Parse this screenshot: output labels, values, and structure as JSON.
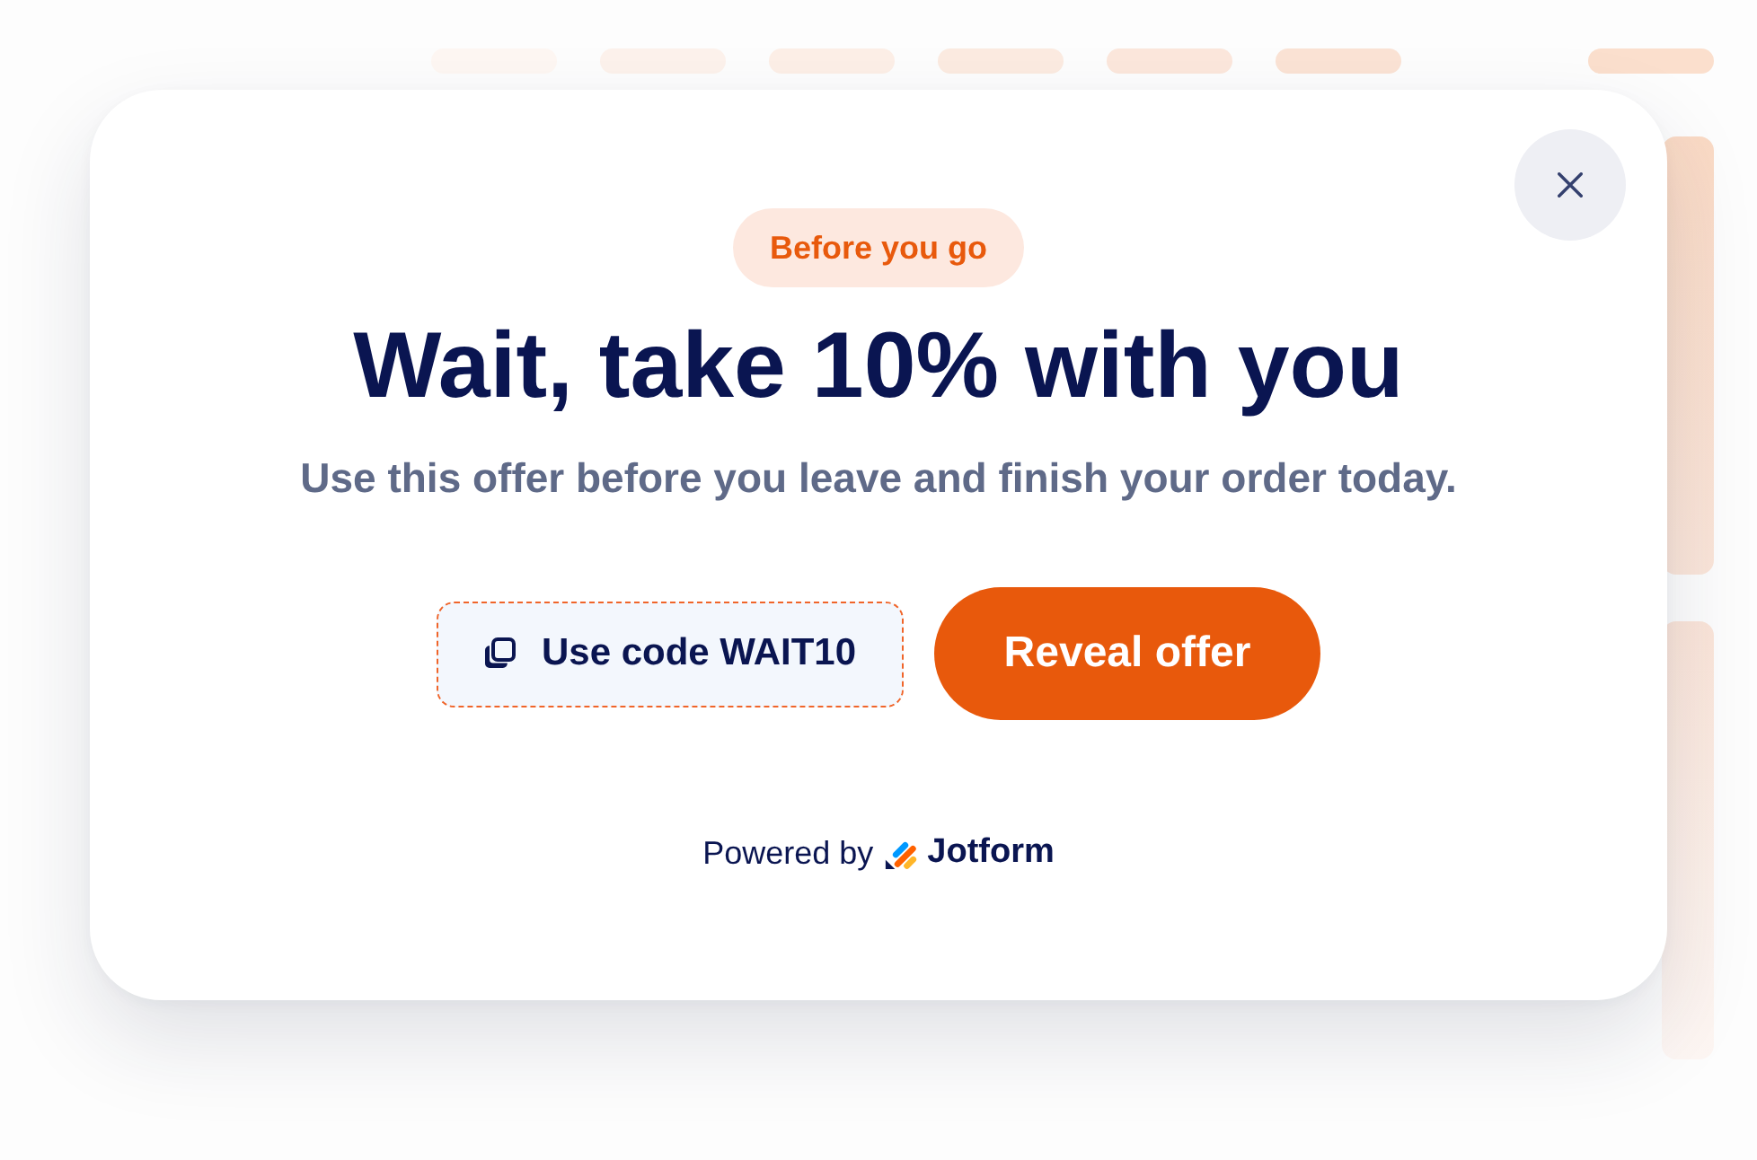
{
  "dialog": {
    "badge": "Before you go",
    "title": "Wait, take 10% with you",
    "message": "Use this offer before you leave and finish your order today.",
    "code_button": {
      "label": "Use code WAIT10"
    },
    "primary_button": {
      "label": "Reveal offer"
    },
    "footer": {
      "prefix": "Powered by",
      "brand": "Jotform"
    }
  }
}
